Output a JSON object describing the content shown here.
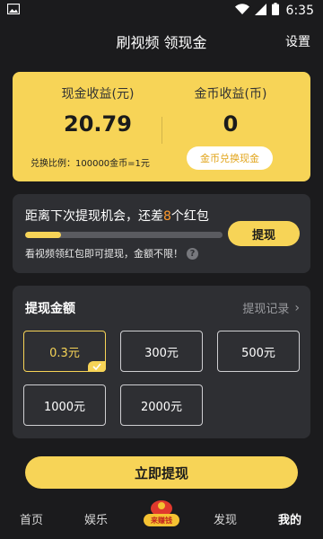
{
  "status_bar": {
    "time": "6:35",
    "icons": [
      "image-icon",
      "wifi-icon",
      "signal-icon",
      "battery-icon"
    ]
  },
  "header": {
    "title": "刷视频 领现金",
    "settings": "设置"
  },
  "earnings": {
    "cash_label": "现金收益(元)",
    "cash_value": "20.79",
    "coin_label": "金币收益(币)",
    "coin_value": "0",
    "exchange_rate": "兑换比例：100000金币=1元",
    "exchange_button": "金币兑换现金"
  },
  "chance": {
    "title_prefix": "距离下次提现机会，还差",
    "title_count": "8",
    "title_suffix": "个红包",
    "progress": 0.18,
    "hint": "看视频领红包即可提现，金额不限！",
    "withdraw_button": "提现"
  },
  "amount": {
    "title": "提现金额",
    "record_link": "提现记录",
    "options": [
      "0.3元",
      "300元",
      "500元",
      "1000元",
      "2000元"
    ],
    "selected_index": 0
  },
  "withdraw_now": "立即提现",
  "nav": {
    "items": [
      "首页",
      "娱乐",
      "发现",
      "我的"
    ],
    "center_badge": "来赚钱",
    "active": "我的"
  },
  "colors": {
    "accent": "#f7d457",
    "highlight": "#ff9a2e",
    "background": "#1b1b1d",
    "card": "#2e2f33"
  }
}
